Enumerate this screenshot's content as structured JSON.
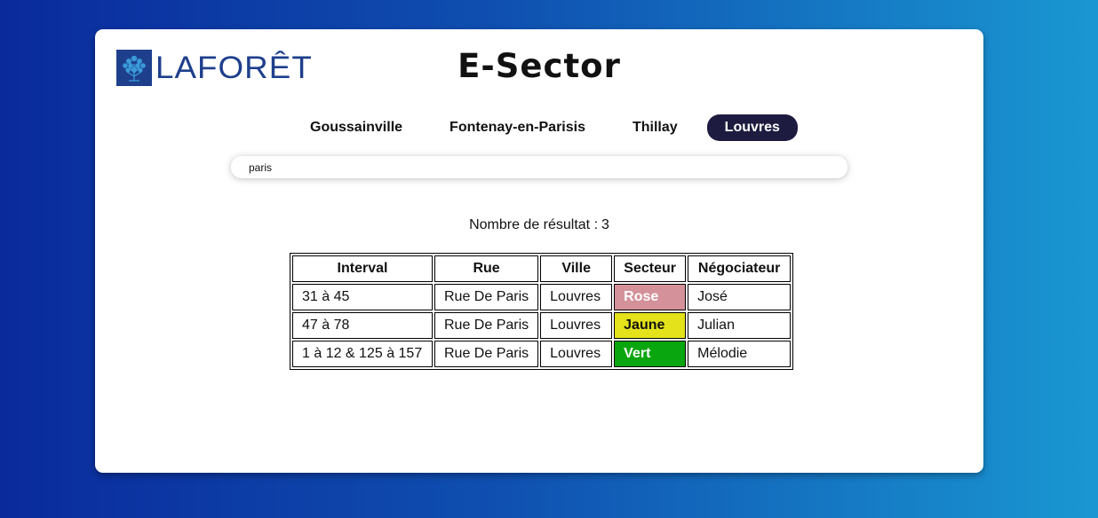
{
  "header": {
    "logo_text": "LAFORÊT",
    "logo_icon": "tree-icon",
    "title": "E-Sector"
  },
  "tabs": [
    {
      "label": "Goussainville",
      "active": false
    },
    {
      "label": "Fontenay-en-Parisis",
      "active": false
    },
    {
      "label": "Thillay",
      "active": false
    },
    {
      "label": "Louvres",
      "active": true
    }
  ],
  "search": {
    "value": "paris"
  },
  "results": {
    "count_label": "Nombre de résultat :",
    "count": "3",
    "columns": [
      "Interval",
      "Rue",
      "Ville",
      "Secteur",
      "Négociateur"
    ],
    "rows": [
      {
        "interval": "31 à 45",
        "rue": "Rue De Paris",
        "ville": "Louvres",
        "secteur": "Rose",
        "negociateur": "José"
      },
      {
        "interval": "47 à 78",
        "rue": "Rue De Paris",
        "ville": "Louvres",
        "secteur": "Jaune",
        "negociateur": "Julian"
      },
      {
        "interval": "1 à 12 & 125 à 157",
        "rue": "Rue De Paris",
        "ville": "Louvres",
        "secteur": "Vert",
        "negociateur": "Mélodie"
      }
    ]
  },
  "colors": {
    "brand": "#1e3f8c",
    "active_tab": "#1d1b3f",
    "sector_rose": "#d4919a",
    "sector_jaune": "#e4e21a",
    "sector_vert": "#0aa60f"
  }
}
